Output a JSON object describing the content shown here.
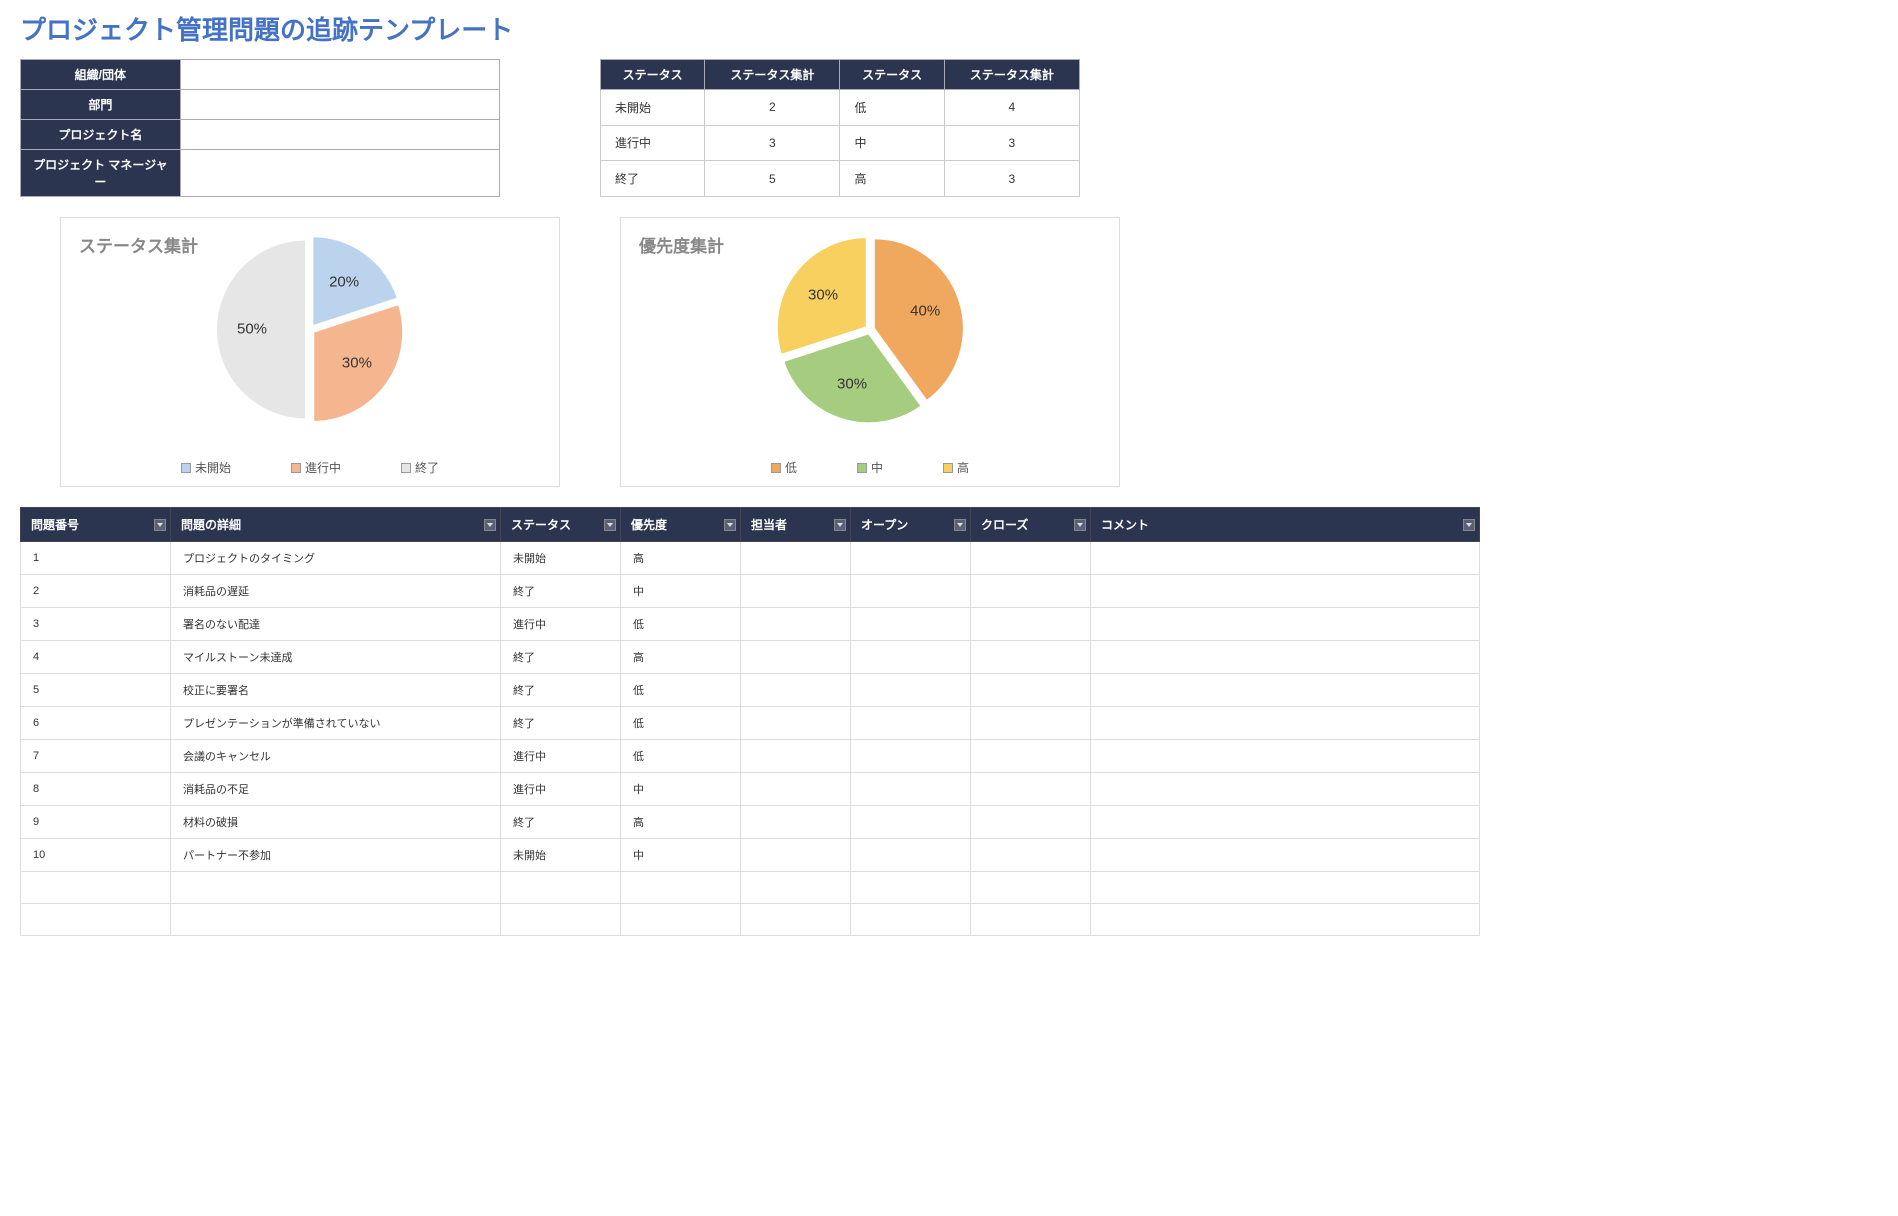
{
  "title": "プロジェクト管理問題の追跡テンプレート",
  "project_info": {
    "labels": [
      "組織/団体",
      "部門",
      "プロジェクト名",
      "プロジェクト マネージャー"
    ],
    "values": [
      "",
      "",
      "",
      ""
    ]
  },
  "summary": {
    "headers": [
      "ステータス",
      "ステータス集計",
      "ステータス",
      "ステータス集計"
    ],
    "rows": [
      [
        "未開始",
        "2",
        "低",
        "4"
      ],
      [
        "進行中",
        "3",
        "中",
        "3"
      ],
      [
        "終了",
        "5",
        "高",
        "3"
      ]
    ]
  },
  "chart_data": [
    {
      "type": "pie",
      "title": "ステータス集計",
      "categories": [
        "未開始",
        "進行中",
        "終了"
      ],
      "values": [
        20,
        30,
        50
      ],
      "colors": [
        "#bcd3ee",
        "#f5b68f",
        "#e6e6e6"
      ],
      "labels": [
        "20%",
        "30%",
        "50%"
      ]
    },
    {
      "type": "pie",
      "title": "優先度集計",
      "categories": [
        "低",
        "中",
        "高"
      ],
      "values": [
        40,
        30,
        30
      ],
      "colors": [
        "#f0a85e",
        "#a6cc7f",
        "#f7d060"
      ],
      "labels": [
        "40%",
        "30%",
        "30%"
      ]
    }
  ],
  "issues": {
    "headers": [
      "問題番号",
      "問題の詳細",
      "ステータス",
      "優先度",
      "担当者",
      "オープン",
      "クローズ",
      "コメント"
    ],
    "rows": [
      [
        "1",
        "プロジェクトのタイミング",
        "未開始",
        "高",
        "",
        "",
        "",
        ""
      ],
      [
        "2",
        "消耗品の遅延",
        "終了",
        "中",
        "",
        "",
        "",
        ""
      ],
      [
        "3",
        "署名のない配達",
        "進行中",
        "低",
        "",
        "",
        "",
        ""
      ],
      [
        "4",
        "マイルストーン未達成",
        "終了",
        "高",
        "",
        "",
        "",
        ""
      ],
      [
        "5",
        "校正に要署名",
        "終了",
        "低",
        "",
        "",
        "",
        ""
      ],
      [
        "6",
        "プレゼンテーションが準備されていない",
        "終了",
        "低",
        "",
        "",
        "",
        ""
      ],
      [
        "7",
        "会議のキャンセル",
        "進行中",
        "低",
        "",
        "",
        "",
        ""
      ],
      [
        "8",
        "消耗品の不足",
        "進行中",
        "中",
        "",
        "",
        "",
        ""
      ],
      [
        "9",
        "材料の破損",
        "終了",
        "高",
        "",
        "",
        "",
        ""
      ],
      [
        "10",
        "パートナー不参加",
        "未開始",
        "中",
        "",
        "",
        "",
        ""
      ],
      [
        "",
        "",
        "",
        "",
        "",
        "",
        "",
        ""
      ],
      [
        "",
        "",
        "",
        "",
        "",
        "",
        "",
        ""
      ]
    ]
  }
}
